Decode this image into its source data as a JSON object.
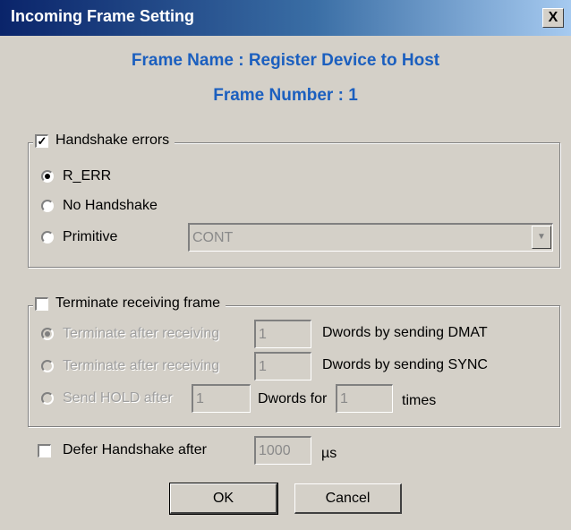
{
  "window": {
    "title": "Incoming Frame Setting",
    "close_label": "X"
  },
  "header": {
    "frame_name": "Frame Name : Register Device to Host",
    "frame_number": "Frame Number : 1"
  },
  "handshake_errors": {
    "label": "Handshake errors",
    "checked": true,
    "options": [
      {
        "label": "R_ERR",
        "selected": true
      },
      {
        "label": "No Handshake",
        "selected": false
      },
      {
        "label": "Primitive",
        "selected": false
      }
    ],
    "primitive_value": "CONT"
  },
  "terminate": {
    "label": "Terminate receiving frame",
    "checked": false,
    "rows": [
      {
        "label": "Terminate after receiving",
        "value": "1",
        "suffix": "Dwords by sending DMAT",
        "selected": true
      },
      {
        "label": "Terminate after receiving",
        "value": "1",
        "suffix": "Dwords by sending SYNC",
        "selected": false
      }
    ],
    "hold": {
      "label": "Send HOLD after",
      "value": "1",
      "mid": "Dwords for",
      "times_value": "1",
      "suffix": "times"
    }
  },
  "defer": {
    "label": "Defer Handshake after",
    "checked": false,
    "value": "1000",
    "unit": "µs"
  },
  "buttons": {
    "ok": "OK",
    "cancel": "Cancel"
  }
}
